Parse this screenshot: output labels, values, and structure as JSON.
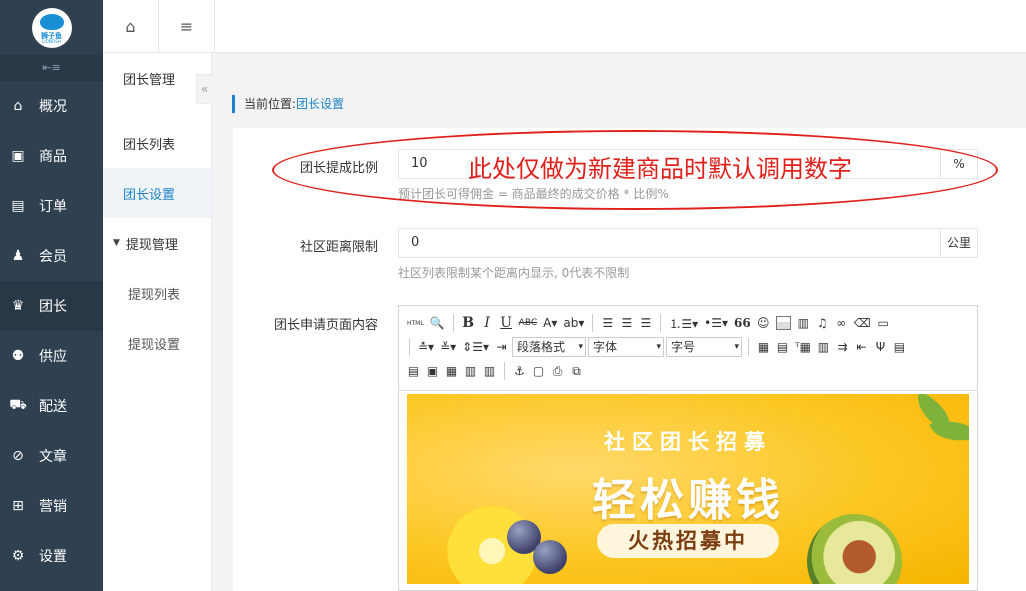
{
  "logo": {
    "text": "狮子鱼",
    "sub": "LIONFISH"
  },
  "sidebar": {
    "collapse_glyph": "⇤≡",
    "items": [
      {
        "icon": "home-icon",
        "glyph": "⌂",
        "label": "概况"
      },
      {
        "icon": "inbox-icon",
        "glyph": "▣",
        "label": "商品"
      },
      {
        "icon": "file-icon",
        "glyph": "▤",
        "label": "订单"
      },
      {
        "icon": "users-icon",
        "glyph": "♟",
        "label": "会员"
      },
      {
        "icon": "crown-icon",
        "glyph": "♛",
        "label": "团长"
      },
      {
        "icon": "supplier-icon",
        "glyph": "⚉",
        "label": "供应"
      },
      {
        "icon": "truck-icon",
        "glyph": "⛟",
        "label": "配送"
      },
      {
        "icon": "compass-icon",
        "glyph": "⊘",
        "label": "文章"
      },
      {
        "icon": "gift-icon",
        "glyph": "⊞",
        "label": "营销"
      },
      {
        "icon": "gear-icon",
        "glyph": "⚙",
        "label": "设置"
      }
    ]
  },
  "topbar": {
    "home_glyph": "⌂",
    "menu_glyph": "≡"
  },
  "submenu": {
    "fold_glyph": "«",
    "title": "团长管理",
    "list": "团长列表",
    "settings": "团长设置",
    "withdraw_group": "提现管理",
    "withdraw_list": "提现列表",
    "withdraw_settings": "提现设置"
  },
  "breadcrumb": {
    "prefix": "当前位置:",
    "current": "团长设置"
  },
  "form": {
    "commission": {
      "label": "团长提成比例",
      "value": "10",
      "unit": "%",
      "help": "预计团长可得佣金 = 商品最终的成交价格 * 比例%"
    },
    "distance": {
      "label": "社区距离限制",
      "value": "0",
      "unit": "公里",
      "help": "社区列表限制某个距离内显示, 0代表不限制"
    },
    "apply_content": {
      "label": "团长申请页面内容"
    }
  },
  "editor": {
    "toolbar": {
      "html": "HTML",
      "bold": "B",
      "italic": "I",
      "underline": "U",
      "strike": "ABC",
      "font_color": "A",
      "quote": "66",
      "paragraph": "段落格式",
      "font_family": "字体",
      "font_size": "字号"
    },
    "banner": {
      "line1": "社区团长招募",
      "line2": "轻松赚钱",
      "pill": "火热招募中"
    }
  },
  "annotation": {
    "text": "此处仅做为新建商品时默认调用数字",
    "color": "#e0201b"
  },
  "colors": {
    "sidebar": "#2f4050",
    "accent": "#1c84c6",
    "annotation": "#e0201b"
  }
}
